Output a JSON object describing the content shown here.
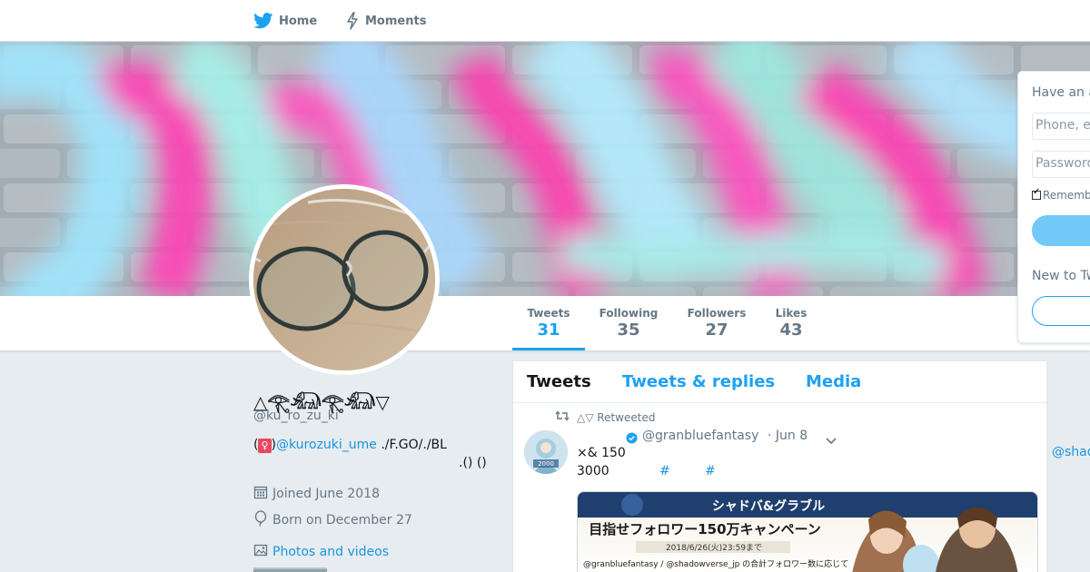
{
  "nav": {
    "home_label": "Home",
    "moments_label": "Moments"
  },
  "profile": {
    "name": "△𓂀𓃰𓂀𓃰▽",
    "handle": "@ku_ro_zu_ki",
    "bio_open": "(",
    "bio_gender": "♀",
    "bio_close": ")",
    "bio_mention": "@kurozuki_ume",
    "bio_rest": " ./F.GO/./BL",
    "bio_line2": ".() ()",
    "joined": "Joined June 2018",
    "born": "Born on December 27",
    "photos_label": "Photos and videos"
  },
  "stats": [
    {
      "label": "Tweets",
      "value": "31"
    },
    {
      "label": "Following",
      "value": "35"
    },
    {
      "label": "Followers",
      "value": "27"
    },
    {
      "label": "Likes",
      "value": "43"
    }
  ],
  "timeline": {
    "tabs": [
      "Tweets",
      "Tweets & replies",
      "Media"
    ],
    "retweeted_label": "△▽ Retweeted",
    "tweet": {
      "handle": "@granbluefantasy",
      "time": "· Jun 8",
      "line1": "×& 150",
      "line2": "3000",
      "hashtag1": "#",
      "hashtag2": "#",
      "avatar_caption": "2000",
      "media_title_top": "シャドバ&グラブル",
      "media_title": "目指せフォロワー150万キャンペーン",
      "media_period": "2018/6/26(火)23:59まで",
      "media_accounts": "@granbluefantasy / @shadowverse_jp の合計フォロワー数に応じて"
    }
  },
  "side_mention": "@shad",
  "login": {
    "title": "Have an a",
    "phone_placeholder": "Phone, e",
    "password_placeholder": "Password",
    "remember_label": "Rememb",
    "new_title": "New to Tw"
  },
  "colors": {
    "accent": "#1da1f2",
    "link": "#1b95e0",
    "page_bg": "#e6ecf0"
  }
}
